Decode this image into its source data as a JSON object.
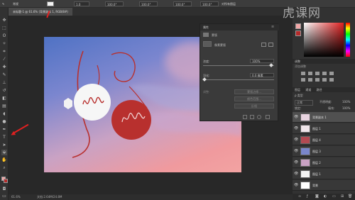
{
  "optionbar": {
    "mode_label": "常规",
    "opacity_value": "1.0",
    "field1": "100.0°",
    "field2": "100.0°",
    "field3": "100.0°",
    "field4": "100.0°",
    "checkbox_label": "对所有图层"
  },
  "document": {
    "tab_title": "未标题-1 @ 61.6% (背景副本 1, RGB/8#)",
    "status_zoom": "61.6%",
    "status_info": "文档:2.64M/24.8M"
  },
  "watermark": "虎课网",
  "properties_panel": {
    "title": "属性",
    "subtitle": "蒙版",
    "mask_label": "像素蒙版",
    "density_label": "浓度:",
    "density_value": "100%",
    "feather_label": "羽化:",
    "feather_value": "0.0 像素",
    "refine_label": "调整:",
    "btn_edge": "蒙版边缘...",
    "btn_color": "颜色范围...",
    "btn_invert": "反相"
  },
  "color_panel": {
    "tab1": "颜色",
    "tab2": "色板"
  },
  "adjust_panel": {
    "tab1": "调整",
    "tab2": "添加调整"
  },
  "layers_panel": {
    "tab1": "图层",
    "tab2": "通道",
    "tab3": "路径",
    "kind_label": "ρ 类型",
    "blend_mode": "正常",
    "opacity_label": "不透明度:",
    "opacity_value": "100%",
    "lock_label": "锁定:",
    "fill_label": "填充:",
    "fill_value": "100%",
    "layers": [
      {
        "name": "背景副本 1",
        "selected": true,
        "thumb": "#e8d4e0"
      },
      {
        "name": "图层 1",
        "selected": false,
        "thumb": "#f0e6ea"
      },
      {
        "name": "图层 4",
        "selected": false,
        "thumb": "#b34a52"
      },
      {
        "name": "图层 3",
        "selected": false,
        "thumb": "#7a86cc"
      },
      {
        "name": "图层 2",
        "selected": false,
        "thumb": "#c9a2c4"
      },
      {
        "name": "图层 1",
        "selected": false,
        "thumb": "#f4f4f4"
      },
      {
        "name": "背景",
        "selected": false,
        "thumb": "#ffffff"
      }
    ]
  },
  "colors": {
    "accent_red": "#b8302e",
    "arrow_red": "#e02020",
    "circle_white": "#f6f6f6"
  }
}
